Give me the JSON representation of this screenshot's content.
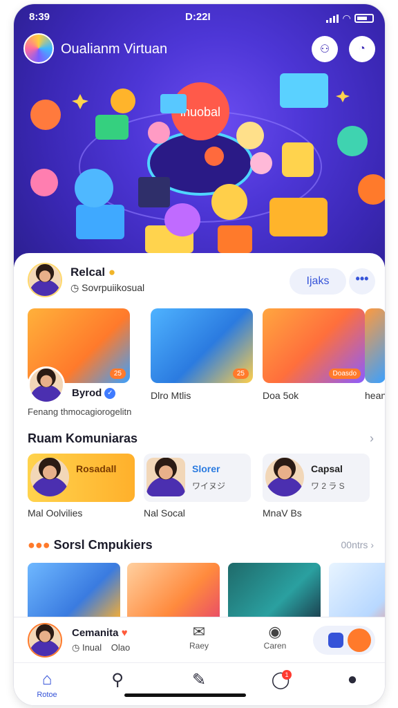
{
  "status": {
    "time": "8:39",
    "center": "D:22I"
  },
  "app": {
    "title": "Oualianm Virtuan",
    "hero_badge": "inuobal"
  },
  "colors": {
    "accent": "#3553d8",
    "hero": "#4d36d6",
    "orange": "#ff7a2b"
  },
  "profile": {
    "name": "Relcal",
    "sub": "Sovrpuiikosual",
    "action": "Ijaks",
    "more": "•••"
  },
  "stories": [
    {
      "label": "Byrod",
      "tag": "25",
      "verified": true
    },
    {
      "label": "Dlro Mtlis",
      "tag": "25"
    },
    {
      "label": "Doa 5ok",
      "tag": "Doasdo"
    },
    {
      "label": "hean"
    }
  ],
  "stories_caption": "Fenang thmocagiorogelitn",
  "community": {
    "title": "Ruam Komuniaras",
    "items": [
      {
        "label": "Mal Oolvilies",
        "text": "Rosadall"
      },
      {
        "label": "Nal Socal",
        "text": "Slorer",
        "sub": "ワイヌジ"
      },
      {
        "label": "MnaV Bs",
        "text": "Capsal",
        "sub": "ワ 2 ラ S"
      }
    ]
  },
  "social": {
    "title": "Sorsl Cmpukiers",
    "more": "00ntrs",
    "items": [
      "a",
      "b",
      "c",
      "d"
    ]
  },
  "player": {
    "name": "Cemanita",
    "sub": "Inual",
    "sub2": "Olao",
    "action1": "Raey",
    "action2": "Caren"
  },
  "nav": {
    "home": "Rotoe",
    "badge": "1"
  }
}
